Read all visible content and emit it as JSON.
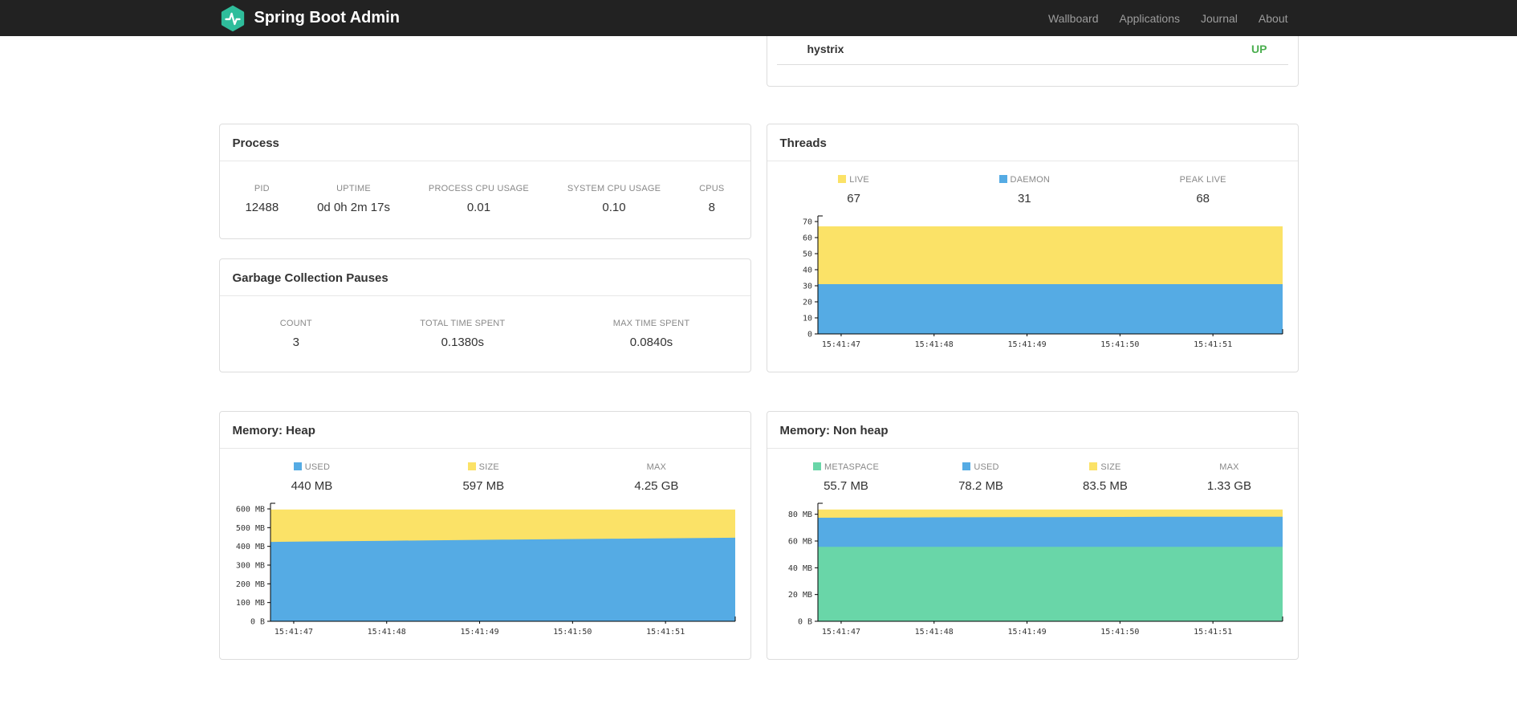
{
  "navbar": {
    "brand": "Spring Boot Admin",
    "links": [
      "Wallboard",
      "Applications",
      "Journal",
      "About"
    ],
    "brand_color": "#2FBD9B"
  },
  "status_panel": {
    "app_name": "hystrix",
    "status": "UP",
    "status_color": "#4CAF50"
  },
  "process": {
    "title": "Process",
    "stats": [
      {
        "label": "PID",
        "value": "12488"
      },
      {
        "label": "UPTIME",
        "value": "0d 0h 2m 17s"
      },
      {
        "label": "PROCESS CPU USAGE",
        "value": "0.01"
      },
      {
        "label": "SYSTEM CPU USAGE",
        "value": "0.10"
      },
      {
        "label": "CPUS",
        "value": "8"
      }
    ]
  },
  "gc": {
    "title": "Garbage Collection Pauses",
    "stats": [
      {
        "label": "COUNT",
        "value": "3"
      },
      {
        "label": "TOTAL TIME SPENT",
        "value": "0.1380s"
      },
      {
        "label": "MAX TIME SPENT",
        "value": "0.0840s"
      }
    ]
  },
  "threads_panel": {
    "title": "Threads",
    "legend": [
      {
        "label": "LIVE",
        "value": "67",
        "color": "#FBE267"
      },
      {
        "label": "DAEMON",
        "value": "31",
        "color": "#55ABE4"
      },
      {
        "label": "PEAK LIVE",
        "value": "68",
        "color": ""
      }
    ]
  },
  "heap_panel": {
    "title": "Memory: Heap",
    "legend": [
      {
        "label": "USED",
        "value": "440 MB",
        "color": "#55ABE4"
      },
      {
        "label": "SIZE",
        "value": "597 MB",
        "color": "#FBE267"
      },
      {
        "label": "MAX",
        "value": "4.25 GB",
        "color": ""
      }
    ]
  },
  "nonheap_panel": {
    "title": "Memory: Non heap",
    "legend": [
      {
        "label": "METASPACE",
        "value": "55.7 MB",
        "color": "#69D6A8"
      },
      {
        "label": "USED",
        "value": "78.2 MB",
        "color": "#55ABE4"
      },
      {
        "label": "SIZE",
        "value": "83.5 MB",
        "color": "#FBE267"
      },
      {
        "label": "MAX",
        "value": "1.33 GB",
        "color": ""
      }
    ]
  },
  "chart_data": [
    {
      "name": "threads",
      "type": "area",
      "title": "Threads",
      "x": [
        "15:41:47",
        "15:41:48",
        "15:41:49",
        "15:41:50",
        "15:41:51"
      ],
      "ymax": 70,
      "ylim": [
        0,
        70
      ],
      "yticks": [
        {
          "v": 0,
          "label": "0"
        },
        {
          "v": 10,
          "label": "10"
        },
        {
          "v": 20,
          "label": "20"
        },
        {
          "v": 30,
          "label": "30"
        },
        {
          "v": 40,
          "label": "40"
        },
        {
          "v": 50,
          "label": "50"
        },
        {
          "v": 60,
          "label": "60"
        },
        {
          "v": 70,
          "label": "70"
        }
      ],
      "series": [
        {
          "name": "LIVE",
          "color": "#FBE267",
          "values": [
            67,
            67,
            67,
            67,
            67
          ]
        },
        {
          "name": "DAEMON",
          "color": "#55ABE4",
          "values": [
            31,
            31,
            31,
            31,
            31
          ]
        }
      ]
    },
    {
      "name": "heap",
      "type": "area",
      "title": "Memory: Heap",
      "x": [
        "15:41:47",
        "15:41:48",
        "15:41:49",
        "15:41:50",
        "15:41:51"
      ],
      "ymax": 600,
      "ylim": [
        0,
        600
      ],
      "yticks": [
        {
          "v": 0,
          "label": "0 B"
        },
        {
          "v": 100,
          "label": "100 MB"
        },
        {
          "v": 200,
          "label": "200 MB"
        },
        {
          "v": 300,
          "label": "300 MB"
        },
        {
          "v": 400,
          "label": "400 MB"
        },
        {
          "v": 500,
          "label": "500 MB"
        },
        {
          "v": 600,
          "label": "600 MB"
        }
      ],
      "series": [
        {
          "name": "SIZE",
          "color": "#FBE267",
          "values": [
            597,
            597,
            597,
            597,
            597
          ]
        },
        {
          "name": "USED",
          "color": "#55ABE4",
          "values": [
            424,
            430,
            436,
            441,
            446
          ]
        }
      ]
    },
    {
      "name": "nonheap",
      "type": "area",
      "title": "Memory: Non heap",
      "x": [
        "15:41:47",
        "15:41:48",
        "15:41:49",
        "15:41:50",
        "15:41:51"
      ],
      "ymax": 84,
      "ylim": [
        0,
        84
      ],
      "yticks": [
        {
          "v": 0,
          "label": "0 B"
        },
        {
          "v": 20,
          "label": "20 MB"
        },
        {
          "v": 40,
          "label": "40 MB"
        },
        {
          "v": 60,
          "label": "60 MB"
        },
        {
          "v": 80,
          "label": "80 MB"
        }
      ],
      "series": [
        {
          "name": "SIZE",
          "color": "#FBE267",
          "values": [
            83.5,
            83.5,
            83.5,
            83.5,
            83.5
          ]
        },
        {
          "name": "USED",
          "color": "#55ABE4",
          "values": [
            77.4,
            77.7,
            77.9,
            78.1,
            78.2
          ]
        },
        {
          "name": "METASPACE",
          "color": "#69D6A8",
          "values": [
            55.7,
            55.7,
            55.7,
            55.7,
            55.7
          ]
        }
      ]
    }
  ]
}
